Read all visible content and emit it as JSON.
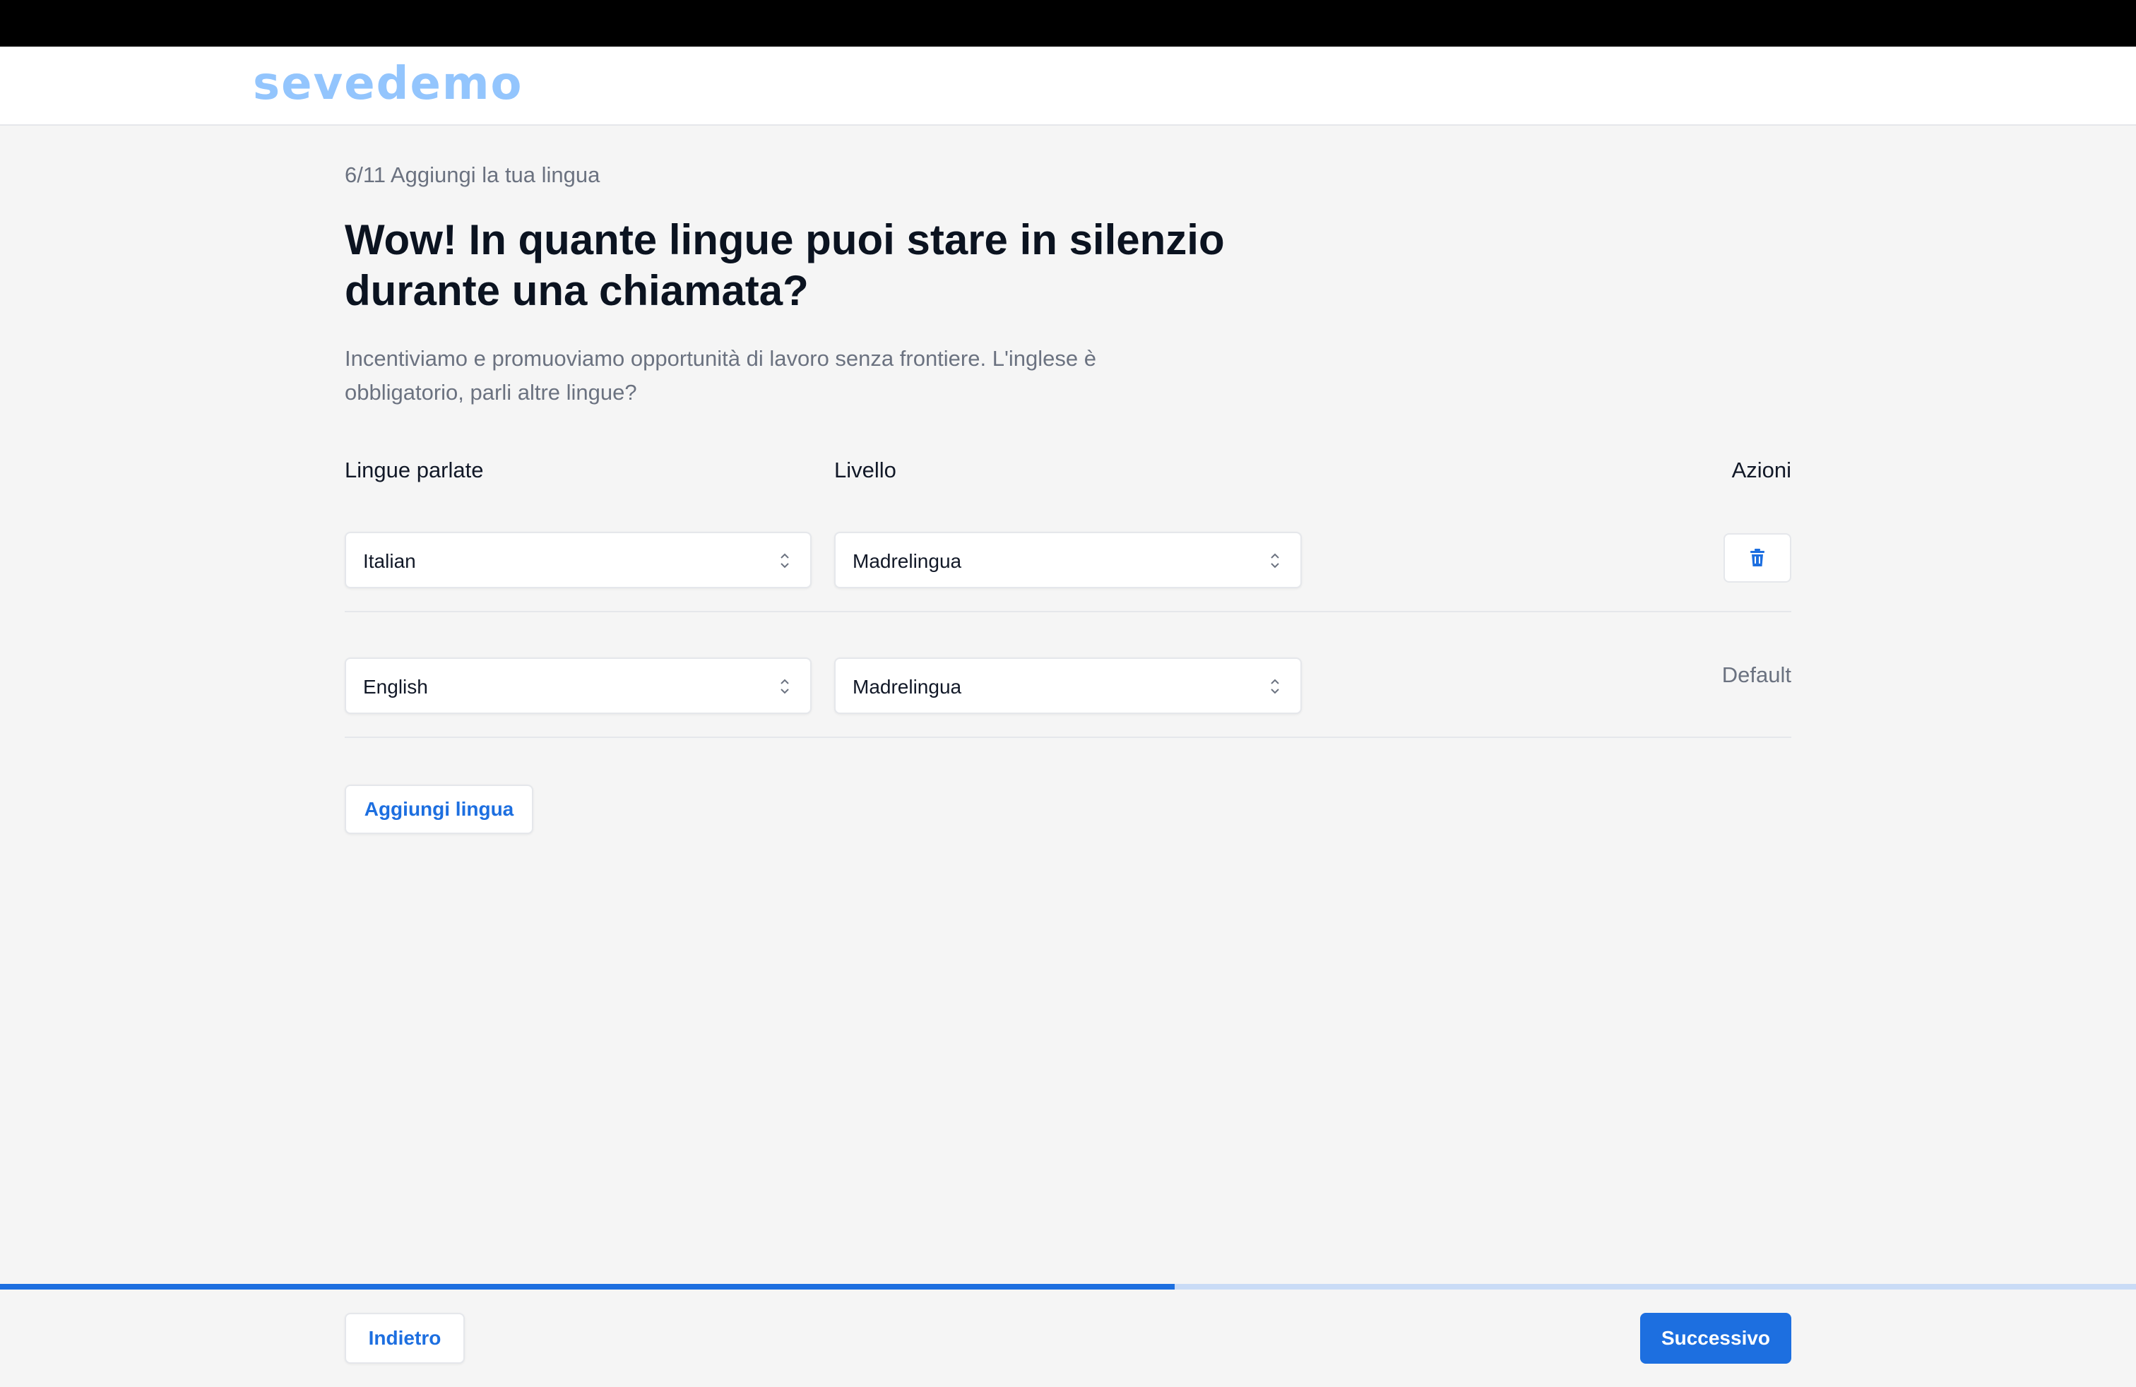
{
  "header": {
    "logo_text": "sevedemo"
  },
  "step": {
    "label": "6/11 Aggiungi la tua lingua"
  },
  "title": {
    "line1": "Wow! In quante lingue puoi stare in silenzio",
    "line2": "durante una chiamata?"
  },
  "subtitle": {
    "line1": "Incentiviamo e promuoviamo opportunità di lavoro senza frontiere. L'inglese è",
    "line2": "obbligatorio, parli altre lingue?"
  },
  "table": {
    "headers": {
      "language": "Lingue parlate",
      "level": "Livello",
      "actions": "Azioni"
    },
    "rows": [
      {
        "language": "Italian",
        "level": "Madrelingua",
        "action": "trash-icon"
      },
      {
        "language": "English",
        "level": "Madrelingua",
        "action_label": "Default"
      }
    ]
  },
  "add_language": {
    "label": "Aggiungi lingua"
  },
  "progress": {
    "fraction": 0.55
  },
  "footer": {
    "back_label": "Indietro",
    "next_label": "Successivo"
  },
  "colors": {
    "accent": "#1d6fe0",
    "logo": "#93c5fd",
    "progress_track": "#c9dbf6",
    "background": "#f5f5f5"
  }
}
